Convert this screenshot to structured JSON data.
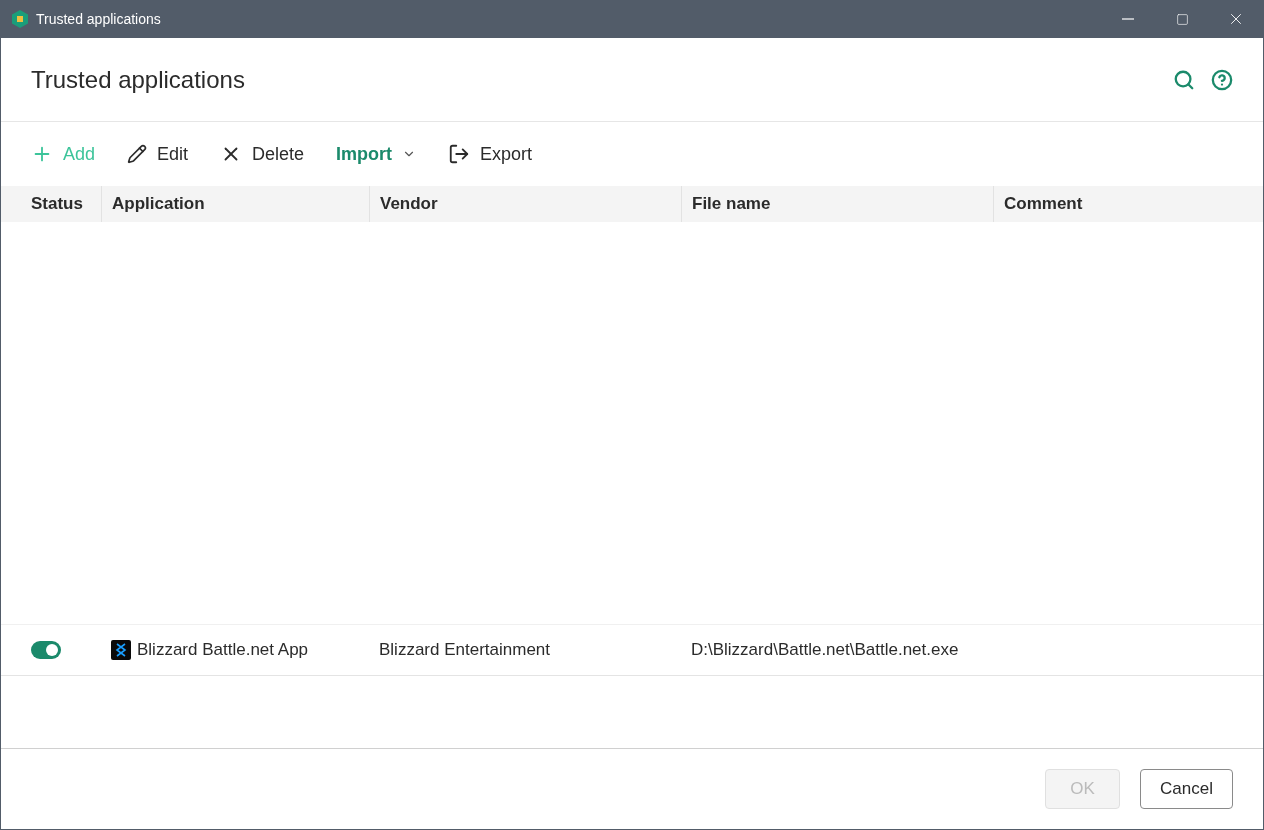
{
  "window": {
    "title": "Trusted applications"
  },
  "header": {
    "title": "Trusted applications"
  },
  "toolbar": [
    {
      "kind": "add",
      "label": "Add",
      "hovered": true
    },
    {
      "kind": "edit",
      "label": "Edit",
      "hovered": false
    },
    {
      "kind": "delete",
      "label": "Delete",
      "hovered": false
    },
    {
      "kind": "dropdown",
      "label": "Import",
      "hovered": false
    },
    {
      "kind": "export",
      "label": "Export",
      "hovered": false
    }
  ],
  "table": {
    "columns": [
      "Status",
      "Application",
      "Vendor",
      "File name",
      "Comment"
    ],
    "rows": [
      {
        "on": true,
        "application": "Blizzard Battle.net App",
        "vendor": "Blizzard Entertainment",
        "file_name": "D:\\Blizzard\\Battle.net\\Battle.net.exe"
      }
    ]
  },
  "buttons": [
    {
      "label": "OK",
      "disabled": true
    },
    {
      "label": "Cancel",
      "disabled": false
    }
  ]
}
